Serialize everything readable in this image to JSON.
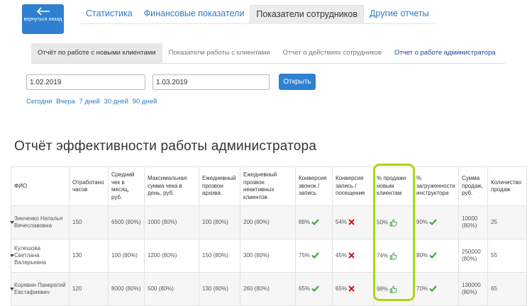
{
  "back_button": {
    "label": "вернуться назад"
  },
  "top_tabs": [
    {
      "label": "Статистика",
      "active": false
    },
    {
      "label": "Финансовые показатели",
      "active": false
    },
    {
      "label": "Показатели сотрудников",
      "active": true
    },
    {
      "label": "Другие отчеты",
      "active": false
    }
  ],
  "sub_tabs": [
    {
      "label": "Отчёт по работе с новыми клиентами",
      "active": true
    },
    {
      "label": "Показатели работы с клиентами",
      "active": false
    },
    {
      "label": "Отчет о действиях сотрудников",
      "active": false
    },
    {
      "label": "Отчет о работе администратора",
      "active": false
    }
  ],
  "filters": {
    "date_from": "1.02.2019",
    "date_to": "1.03.2019",
    "open_label": "Открыть",
    "quick_periods": [
      "Сегодня",
      "Вчера",
      "7 дней",
      "30 дней",
      "90 дней"
    ]
  },
  "report": {
    "title": "Отчёт эффективности работы администратора",
    "columns": [
      "ФИО",
      "Отработано часов",
      "Средний чек в месяц, руб.",
      "Максимальная сумма чека в день, руб.",
      "Ежедневный прозвон архива",
      "Ежедневный прозвон неактивных клиентов",
      "Конверсия звонок / запись",
      "Конверсия запись / посещение",
      "% продажи новым клиентам",
      "% загруженности инструктора",
      "Сумма продаж, руб.",
      "Количество продаж"
    ],
    "rows": [
      {
        "fio": "Зинченко Наталья Вячеславовна",
        "hours": "150",
        "avg_check": "6500 (80%)",
        "max_check": "1000 (80%)",
        "archive_calls": "100 (80%)",
        "inactive_calls": "200 (80%)",
        "conv_call": "88%",
        "conv_visit": "54%",
        "new_sales": "50%",
        "load": "90%",
        "sales_sum": "10000 (80%)",
        "sales_count": "25"
      },
      {
        "fio": "Кулешова Светлана Валерьевна",
        "hours": "130",
        "avg_check": "100 (80%)",
        "max_check": "1200 (80%)",
        "archive_calls": "150 (80%)",
        "inactive_calls": "300 (80%)",
        "conv_call": "75%",
        "conv_visit": "45%",
        "new_sales": "74%",
        "load": "80%",
        "sales_sum": "250000 (80%)",
        "sales_count": "55"
      },
      {
        "fio": "Корявин Панкратий Евстафиевич",
        "hours": "120",
        "avg_check": "8000 (80%)",
        "max_check": "500 (80%)",
        "archive_calls": "130 (80%)",
        "inactive_calls": "260 (80%)",
        "conv_call": "65%",
        "conv_visit": "65%",
        "new_sales": "98%",
        "load": "70%",
        "sales_sum": "130000 (80%)",
        "sales_count": "65"
      }
    ]
  },
  "icons": {
    "positive": "check-icon",
    "negative": "cross-icon",
    "sales": "thumbs-up-icon"
  },
  "colors": {
    "primary": "#2f80d1",
    "success": "#3aa83a",
    "danger": "#d21a1a",
    "highlight": "#a9d80f"
  }
}
